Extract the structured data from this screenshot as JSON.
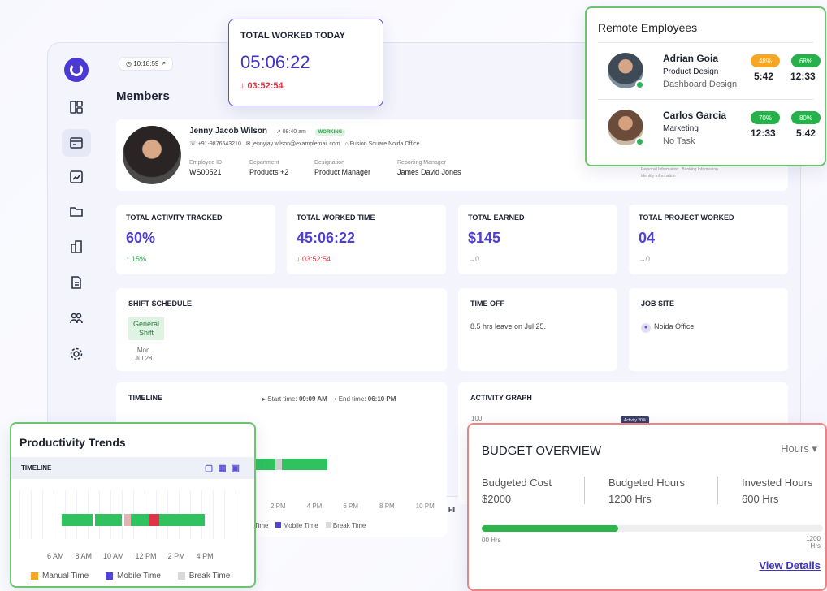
{
  "header": {
    "clock": "10:18:59",
    "page_title": "Members"
  },
  "profile": {
    "name": "Jenny Jacob Wilson",
    "time": "08:40 am",
    "status": "WORKING",
    "phone": "+91-9876543210",
    "email": "jennyjay.wilson@examplemail.com",
    "office": "Fusion Square Noida Office",
    "fields": [
      {
        "label": "Employee ID",
        "value": "WS00521"
      },
      {
        "label": "Department",
        "value": "Products +2"
      },
      {
        "label": "Designation",
        "value": "Product Manager"
      },
      {
        "label": "Reporting Manager",
        "value": "James David Jones"
      }
    ],
    "tabs": [
      "Personal Information",
      "Banking Information",
      "Identity Information"
    ]
  },
  "stats": [
    {
      "title": "TOTAL ACTIVITY TRACKED",
      "value": "60%",
      "delta": "↑ 15%",
      "tone": "g"
    },
    {
      "title": "TOTAL WORKED TIME",
      "value": "45:06:22",
      "delta": "↓ 03:52:54",
      "tone": "r"
    },
    {
      "title": "TOTAL EARNED",
      "value": "$145",
      "delta": "→0",
      "tone": "gr"
    },
    {
      "title": "TOTAL PROJECT WORKED",
      "value": "04",
      "delta": "→0",
      "tone": "gr"
    }
  ],
  "shift": {
    "title": "SHIFT SCHEDULE",
    "name": "General Shift",
    "day": "Mon",
    "date": "Jul 28"
  },
  "timeoff": {
    "title": "TIME OFF",
    "text": "8.5 hrs leave on Jul 25."
  },
  "jobsite": {
    "title": "JOB SITE",
    "place": "Noida Office"
  },
  "timeline": {
    "title": "TIMELINE",
    "start_label": "Start time:",
    "start": "09:09 AM",
    "end_label": "End time:",
    "end": "06:10 PM",
    "ticks": [
      "2 PM",
      "4 PM",
      "6 PM",
      "8 PM",
      "10 PM"
    ],
    "legend": [
      "Time",
      "Mobile Time",
      "Break Time"
    ],
    "hi": "HI"
  },
  "activity": {
    "title": "ACTIVITY GRAPH",
    "y_top": "100",
    "tooltip": "Activity 20%"
  },
  "worked_today": {
    "title": "TOTAL WORKED TODAY",
    "value": "05:06:22",
    "delta": "↓ 03:52:54"
  },
  "remote": {
    "title": "Remote Employees",
    "employees": [
      {
        "name": "Adrian Goia",
        "role": "Product Design",
        "task": "Dashboard Design",
        "p1": "48%",
        "t1": "5:42",
        "p2": "68%",
        "t2": "12:33",
        "c1": "#f5a623",
        "c2": "#27b14a"
      },
      {
        "name": "Carlos Garcia",
        "role": "Marketing",
        "task": "No Task",
        "p1": "70%",
        "t1": "12:33",
        "p2": "80%",
        "t2": "5:42",
        "c1": "#27b14a",
        "c2": "#27b14a"
      }
    ]
  },
  "productivity": {
    "title": "Productivity Trends",
    "sub": "TIMELINE",
    "ticks": [
      "6 AM",
      "8 AM",
      "10 AM",
      "12 PM",
      "2 PM",
      "4 PM"
    ],
    "legend": [
      "Manual Time",
      "Mobile Time",
      "Break Time"
    ],
    "colors": {
      "manual": "#f5a623",
      "mobile": "#5044d8",
      "break": "#d9d9d9"
    }
  },
  "budget": {
    "title": "BUDGET OVERVIEW",
    "unit": "Hours",
    "cols": [
      {
        "label": "Budgeted Cost",
        "value": "$2000"
      },
      {
        "label": "Budgeted Hours",
        "value": "1200 Hrs"
      },
      {
        "label": "Invested Hours",
        "value": "600 Hrs"
      }
    ],
    "progress": 0.4,
    "start": "00 Hrs",
    "end": "1200 Hrs",
    "link": "View Details"
  }
}
